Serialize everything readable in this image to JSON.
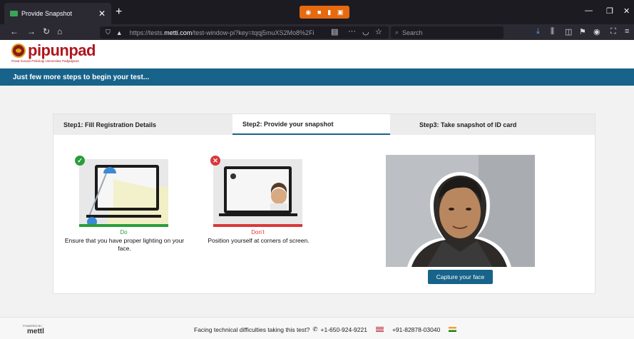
{
  "browser": {
    "tab_title": "Provide Snapshot",
    "tab_close": "✕",
    "new_tab": "+",
    "url_prefix": "https://tests.",
    "url_domain": "metti.com",
    "url_rest": "/test-window-pi?key=tqqj5muXS2Mo8%2Fi",
    "url_dots": "···",
    "search_placeholder": "Search"
  },
  "header": {
    "logo_text": "pipunpad",
    "logo_subtitle": "Pusat Inovasi Psikologi Universitas Padjadjaran"
  },
  "banner": {
    "text": "Just few more steps to begin your test..."
  },
  "steps": [
    {
      "label": "Step1: Fill Registration Details"
    },
    {
      "label": "Step2: Provide your snapshot"
    },
    {
      "label": "Step3: Take snapshot of ID card"
    }
  ],
  "tips": {
    "do": {
      "badge": "✓",
      "title": "Do",
      "text": "Ensure that you have proper lighting on your face.",
      "color": "#2a9d3a"
    },
    "dont": {
      "badge": "✕",
      "title": "Don't",
      "text": "Position yourself at corners of screen.",
      "color": "#d9383a"
    }
  },
  "capture_button": "Capture your face",
  "footer": {
    "powered_label": "POWERED BY",
    "powered_brand": "mettl",
    "help_text": "Facing technical difficulties taking this test?",
    "phone_us": "+1-650-924-9221",
    "phone_in": "+91-82878-03040"
  },
  "colors": {
    "primary": "#17638a",
    "brand_red": "#b0161e"
  }
}
